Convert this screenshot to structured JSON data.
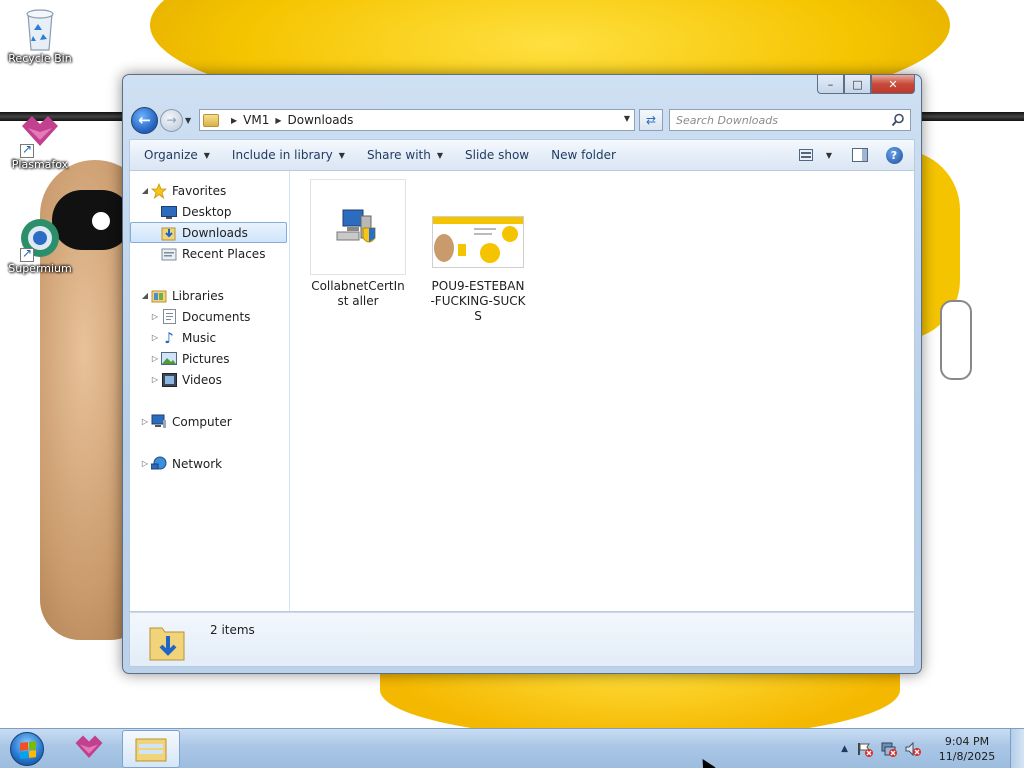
{
  "desktop": {
    "icons": [
      {
        "label": "Recycle Bin"
      },
      {
        "label": "Plasmafox"
      },
      {
        "label": "Supermium"
      }
    ]
  },
  "window": {
    "controls": {
      "minimize": "–",
      "maximize": "□",
      "close": "✕"
    },
    "address": {
      "crumbs": [
        "VM1",
        "Downloads"
      ]
    },
    "search": {
      "placeholder": "Search Downloads",
      "value": ""
    },
    "toolbar": {
      "organize": "Organize",
      "include_in_library": "Include in library",
      "share_with": "Share with",
      "slide_show": "Slide show",
      "new_folder": "New folder",
      "help": "?"
    },
    "nav": {
      "favorites": "Favorites",
      "desktop": "Desktop",
      "downloads": "Downloads",
      "recent_places": "Recent Places",
      "libraries": "Libraries",
      "documents": "Documents",
      "music": "Music",
      "pictures": "Pictures",
      "videos": "Videos",
      "computer": "Computer",
      "network": "Network",
      "selected": "Downloads"
    },
    "files": [
      {
        "name": "CollabnetCertInstaller",
        "display": "CollabnetCertInst aller",
        "kind": "installer"
      },
      {
        "name": "POU9-ESTEBAN-FUCKING-SUCKS",
        "display": "POU9-ESTEBAN-FUCKING-SUCKS",
        "kind": "image"
      }
    ],
    "details": {
      "count_text": "2 items"
    }
  },
  "taskbar": {
    "pinned": [
      "Plasmafox",
      "Windows Explorer"
    ],
    "active": "Windows Explorer",
    "clock": {
      "time": "9:04 PM",
      "date": "11/8/2025"
    }
  },
  "colors": {
    "accent": "#3a7bd5",
    "taskbar": "#a9c6e6",
    "window_frame": "#cfe0f3",
    "selection": "#cfe5fb",
    "plasmafox": "#c2418f"
  }
}
